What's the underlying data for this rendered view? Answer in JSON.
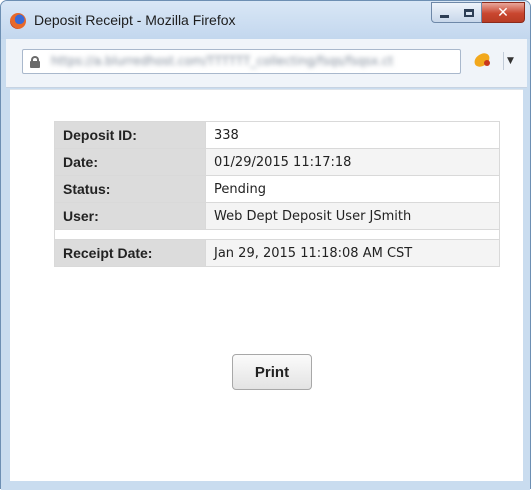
{
  "window": {
    "title": "Deposit Receipt - Mozilla Firefox",
    "close_glyph": "✕",
    "menu_arrow": "▼"
  },
  "toolbar": {
    "url": "https://a.blurredhost.com/TTTTTT_collecting/fsqs/fsqsx.ct"
  },
  "receipt": {
    "rows": [
      {
        "label": "Deposit ID:",
        "value": "338"
      },
      {
        "label": "Date:",
        "value": "01/29/2015 11:17:18"
      },
      {
        "label": "Status:",
        "value": "Pending"
      },
      {
        "label": "User:",
        "value": "Web Dept Deposit User JSmith"
      },
      {
        "label": "Receipt Date:",
        "value": "Jan 29, 2015 11:18:08 AM CST"
      }
    ]
  },
  "actions": {
    "print_label": "Print"
  },
  "icons": {
    "app": "firefox-icon",
    "lock": "lock-icon",
    "addon": "addon-icon"
  },
  "colors": {
    "label_bg": "#dcdcdc",
    "window_frame": "#c9dcef",
    "close_button": "#c9462f"
  }
}
